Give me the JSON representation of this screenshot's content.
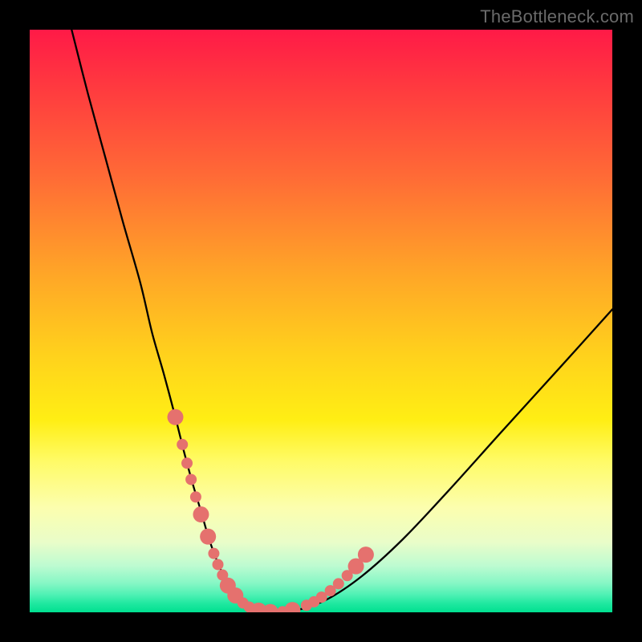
{
  "watermark": "TheBottleneck.com",
  "chart_data": {
    "type": "line",
    "title": "",
    "xlabel": "",
    "ylabel": "",
    "xlim": [
      0,
      100
    ],
    "ylim": [
      0,
      100
    ],
    "series": [
      {
        "name": "curve",
        "x": [
          7.2,
          10,
          13,
          16,
          19,
          21,
          23,
          25,
          26.5,
          28,
          29.5,
          30.5,
          31.5,
          32.5,
          33.5,
          34.5,
          35.5,
          37,
          39,
          42,
          46,
          51,
          57,
          64,
          72,
          81,
          91,
          100
        ],
        "values": [
          100,
          89,
          78,
          67,
          56.5,
          48,
          41,
          33.5,
          27.5,
          22,
          17,
          13.5,
          10.5,
          8,
          5.8,
          4,
          2.6,
          1.3,
          0.4,
          0,
          0.4,
          2.2,
          6.2,
          12.5,
          21,
          31,
          42,
          52
        ]
      }
    ],
    "markers": {
      "name": "dots",
      "color": "#e5716e",
      "radius_large": 10,
      "radius_small": 7,
      "points": [
        {
          "x": 25.0,
          "y": 33.5,
          "r": "large"
        },
        {
          "x": 26.2,
          "y": 28.8,
          "r": "small"
        },
        {
          "x": 27.0,
          "y": 25.6,
          "r": "small"
        },
        {
          "x": 27.7,
          "y": 22.8,
          "r": "small"
        },
        {
          "x": 28.5,
          "y": 19.8,
          "r": "small"
        },
        {
          "x": 29.4,
          "y": 16.8,
          "r": "large"
        },
        {
          "x": 30.6,
          "y": 13.0,
          "r": "large"
        },
        {
          "x": 31.6,
          "y": 10.1,
          "r": "small"
        },
        {
          "x": 32.3,
          "y": 8.2,
          "r": "small"
        },
        {
          "x": 33.1,
          "y": 6.4,
          "r": "small"
        },
        {
          "x": 34.0,
          "y": 4.6,
          "r": "large"
        },
        {
          "x": 35.3,
          "y": 2.9,
          "r": "large"
        },
        {
          "x": 36.6,
          "y": 1.6,
          "r": "small"
        },
        {
          "x": 37.7,
          "y": 0.9,
          "r": "small"
        },
        {
          "x": 39.3,
          "y": 0.3,
          "r": "large"
        },
        {
          "x": 41.3,
          "y": 0.05,
          "r": "large"
        },
        {
          "x": 43.4,
          "y": 0.1,
          "r": "small"
        },
        {
          "x": 45.1,
          "y": 0.4,
          "r": "large"
        },
        {
          "x": 47.5,
          "y": 1.2,
          "r": "small"
        },
        {
          "x": 48.8,
          "y": 1.8,
          "r": "small"
        },
        {
          "x": 50.1,
          "y": 2.6,
          "r": "small"
        },
        {
          "x": 51.6,
          "y": 3.7,
          "r": "small"
        },
        {
          "x": 53.0,
          "y": 4.9,
          "r": "small"
        },
        {
          "x": 54.5,
          "y": 6.3,
          "r": "small"
        },
        {
          "x": 56.0,
          "y": 7.9,
          "r": "large"
        },
        {
          "x": 57.7,
          "y": 9.9,
          "r": "large"
        }
      ]
    }
  }
}
